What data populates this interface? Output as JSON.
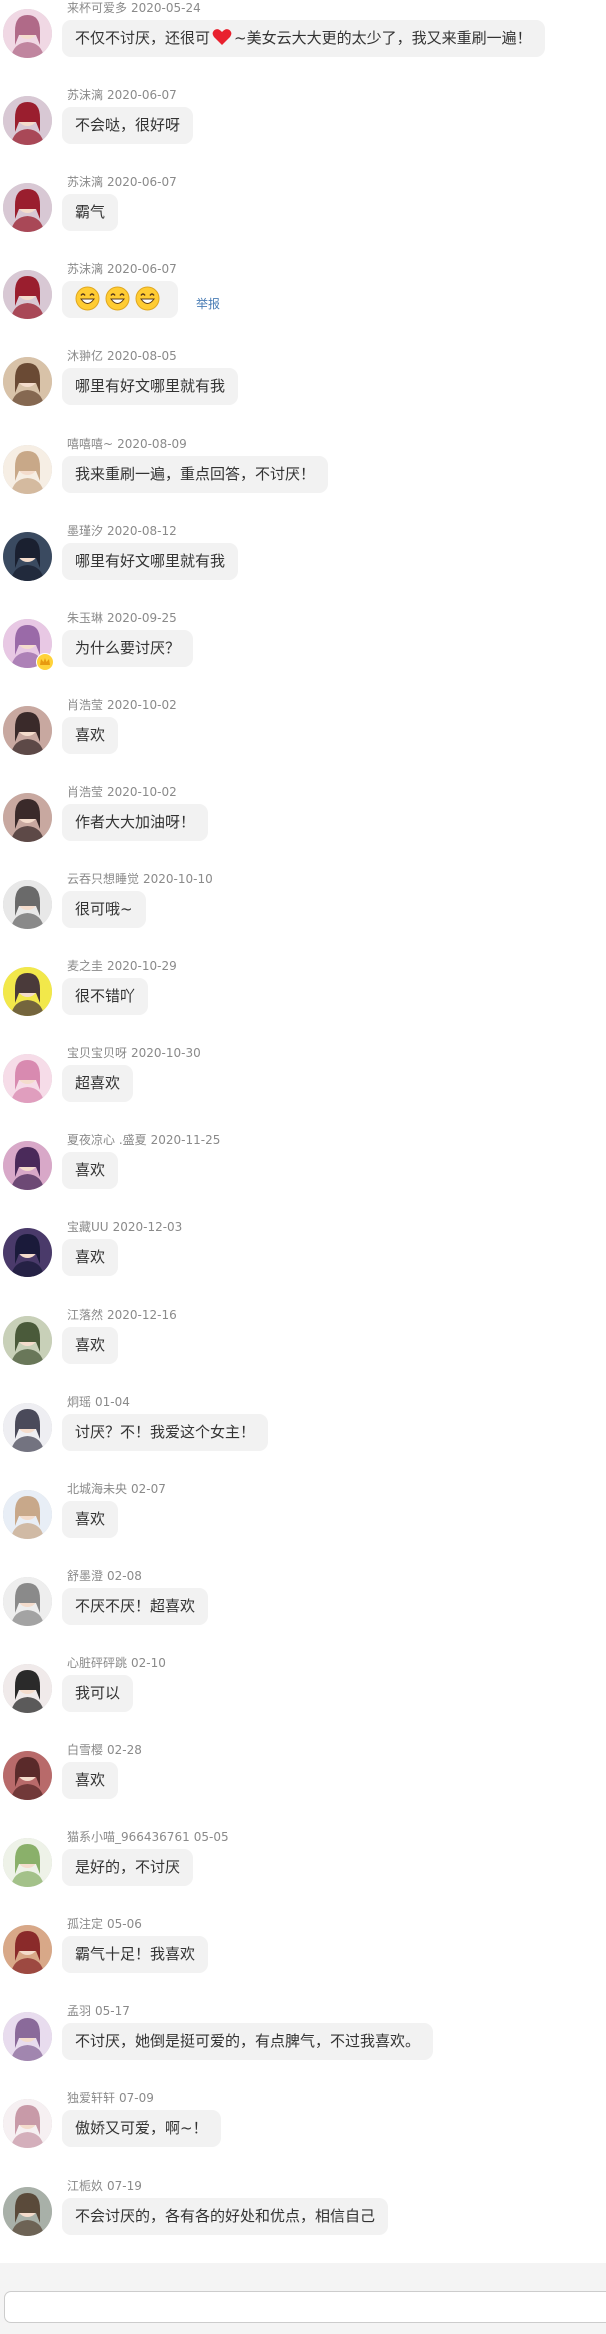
{
  "comments": [
    {
      "user": "来杯可爱多",
      "date": "2020-05-24",
      "text_before": "不仅不讨厌，还很可",
      "text_after": "~美女云大大更的太少了，我又来重刷一遍！",
      "inline_icon": "heart-icon",
      "avatar": "avatar-anime-girl",
      "avatar_colors": [
        "#f0d8e4",
        "#b06a88"
      ]
    },
    {
      "user": "苏沫漓",
      "date": "2020-06-07",
      "text": "不会哒，很好呀",
      "avatar": "avatar-anime-girl",
      "avatar_colors": [
        "#d8c8d4",
        "#9a1e2e"
      ]
    },
    {
      "user": "苏沫漓",
      "date": "2020-06-07",
      "text": "霸气",
      "avatar": "avatar-anime-girl",
      "avatar_colors": [
        "#d8c8d4",
        "#9a1e2e"
      ]
    },
    {
      "user": "苏沫漓",
      "date": "2020-06-07",
      "emoji": [
        "grin-emoji-icon",
        "grin-emoji-icon",
        "grin-emoji-icon"
      ],
      "report": "举报",
      "avatar": "avatar-anime-girl",
      "avatar_colors": [
        "#d8c8d4",
        "#9a1e2e"
      ]
    },
    {
      "user": "沐翀亿",
      "date": "2020-08-05",
      "text": "哪里有好文哪里就有我",
      "avatar": "avatar-photo",
      "avatar_colors": [
        "#d8c2a8",
        "#6a4a34"
      ]
    },
    {
      "user": "嘻嘻嘻~",
      "date": "2020-08-09",
      "text": "我来重刷一遍，重点回答，不讨厌！",
      "avatar": "avatar-anime-girl",
      "avatar_colors": [
        "#f6eee4",
        "#c8a888"
      ]
    },
    {
      "user": "墨瑾汐",
      "date": "2020-08-12",
      "text": "哪里有好文哪里就有我",
      "avatar": "avatar-dark-photo",
      "avatar_colors": [
        "#3a4a60",
        "#1a2030"
      ]
    },
    {
      "user": "朱玉琳",
      "date": "2020-09-25",
      "text": "为什么要讨厌？",
      "avatar": "avatar-anime-girl",
      "avatar_colors": [
        "#e8c8e4",
        "#9a6aa8"
      ],
      "badge": "crown-badge-icon"
    },
    {
      "user": "肖浩莹",
      "date": "2020-10-02",
      "text": "喜欢",
      "avatar": "avatar-photo",
      "avatar_colors": [
        "#c8a8a0",
        "#3a2a2a"
      ]
    },
    {
      "user": "肖浩莹",
      "date": "2020-10-02",
      "text": "作者大大加油呀！",
      "avatar": "avatar-photo",
      "avatar_colors": [
        "#c8a8a0",
        "#3a2a2a"
      ]
    },
    {
      "user": "云吞只想睡觉",
      "date": "2020-10-10",
      "text": "很可哦~",
      "avatar": "avatar-sketch",
      "avatar_colors": [
        "#e8e8e8",
        "#6a6a6a"
      ]
    },
    {
      "user": "麦之圭",
      "date": "2020-10-29",
      "text": "很不错吖",
      "avatar": "avatar-cartoon",
      "avatar_colors": [
        "#f2e84a",
        "#4a3a3a"
      ]
    },
    {
      "user": "宝贝宝贝呀",
      "date": "2020-10-30",
      "text": "超喜欢",
      "avatar": "avatar-anime-girl",
      "avatar_colors": [
        "#f6dce8",
        "#d88ab0"
      ]
    },
    {
      "user": "夏夜凉心 .盛夏",
      "date": "2020-11-25",
      "text": "喜欢",
      "avatar": "avatar-anime-girl",
      "avatar_colors": [
        "#d8a8c8",
        "#4a2a5a"
      ]
    },
    {
      "user": "宝藏UU",
      "date": "2020-12-03",
      "text": "喜欢",
      "avatar": "avatar-anime-girl",
      "avatar_colors": [
        "#4a3a6a",
        "#1a1a3a"
      ]
    },
    {
      "user": "江落然",
      "date": "2020-12-16",
      "text": "喜欢",
      "avatar": "avatar-photo",
      "avatar_colors": [
        "#c8d0b8",
        "#4a5a3a"
      ]
    },
    {
      "user": "炯瑶",
      "date": "01-04",
      "text": "讨厌？不！我爱这个女主！",
      "avatar": "avatar-anime-girl",
      "avatar_colors": [
        "#eeeef2",
        "#4a4a5a"
      ]
    },
    {
      "user": "北城海未央",
      "date": "02-07",
      "text": "喜欢",
      "avatar": "avatar-anime-girl",
      "avatar_colors": [
        "#e8eef6",
        "#c8a88a"
      ]
    },
    {
      "user": "舒墨澄",
      "date": "02-08",
      "text": "不厌不厌！超喜欢",
      "avatar": "avatar-anime-girl",
      "avatar_colors": [
        "#eeeeee",
        "#8a8a8a"
      ]
    },
    {
      "user": "心脏砰砰跳",
      "date": "02-10",
      "text": "我可以",
      "avatar": "avatar-anime-girl",
      "avatar_colors": [
        "#f0eaea",
        "#2a2a2a"
      ]
    },
    {
      "user": "白雪樱",
      "date": "02-28",
      "text": "喜欢",
      "avatar": "avatar-photo",
      "avatar_colors": [
        "#b86a6a",
        "#5a2a2a"
      ]
    },
    {
      "user": "猫系小喵_966436761",
      "date": "05-05",
      "text": "是好的，不讨厌",
      "avatar": "avatar-anime-girl",
      "avatar_colors": [
        "#eef2e8",
        "#8ab06a"
      ]
    },
    {
      "user": "孤注定",
      "date": "05-06",
      "text": "霸气十足！我喜欢",
      "avatar": "avatar-photo",
      "avatar_colors": [
        "#d8a888",
        "#8a2a2a"
      ]
    },
    {
      "user": "孟羽",
      "date": "05-17",
      "text": "不讨厌，她倒是挺可爱的，有点脾气，不过我喜欢。",
      "avatar": "avatar-anime-girl",
      "avatar_colors": [
        "#e8dcee",
        "#8a6a9a"
      ]
    },
    {
      "user": "独爱轩轩",
      "date": "07-09",
      "text": "傲娇又可爱，啊~！",
      "avatar": "avatar-anime-girl",
      "avatar_colors": [
        "#f6f0f2",
        "#c89aa8"
      ]
    },
    {
      "user": "江栀奺",
      "date": "07-19",
      "text": "不会讨厌的，各有各的好处和优点，相信自己",
      "avatar": "avatar-photo",
      "avatar_colors": [
        "#a8b0a8",
        "#5a4a3a"
      ]
    }
  ],
  "footer": {
    "input_value": "",
    "placeholder": ""
  },
  "colors": {
    "bubble": "#f2f2f2",
    "meta_text": "#8a8a8a",
    "body_text": "#333333",
    "report_link": "#4a7db5",
    "heart": "#e8212e",
    "emoji_face": "#ffcc33"
  }
}
